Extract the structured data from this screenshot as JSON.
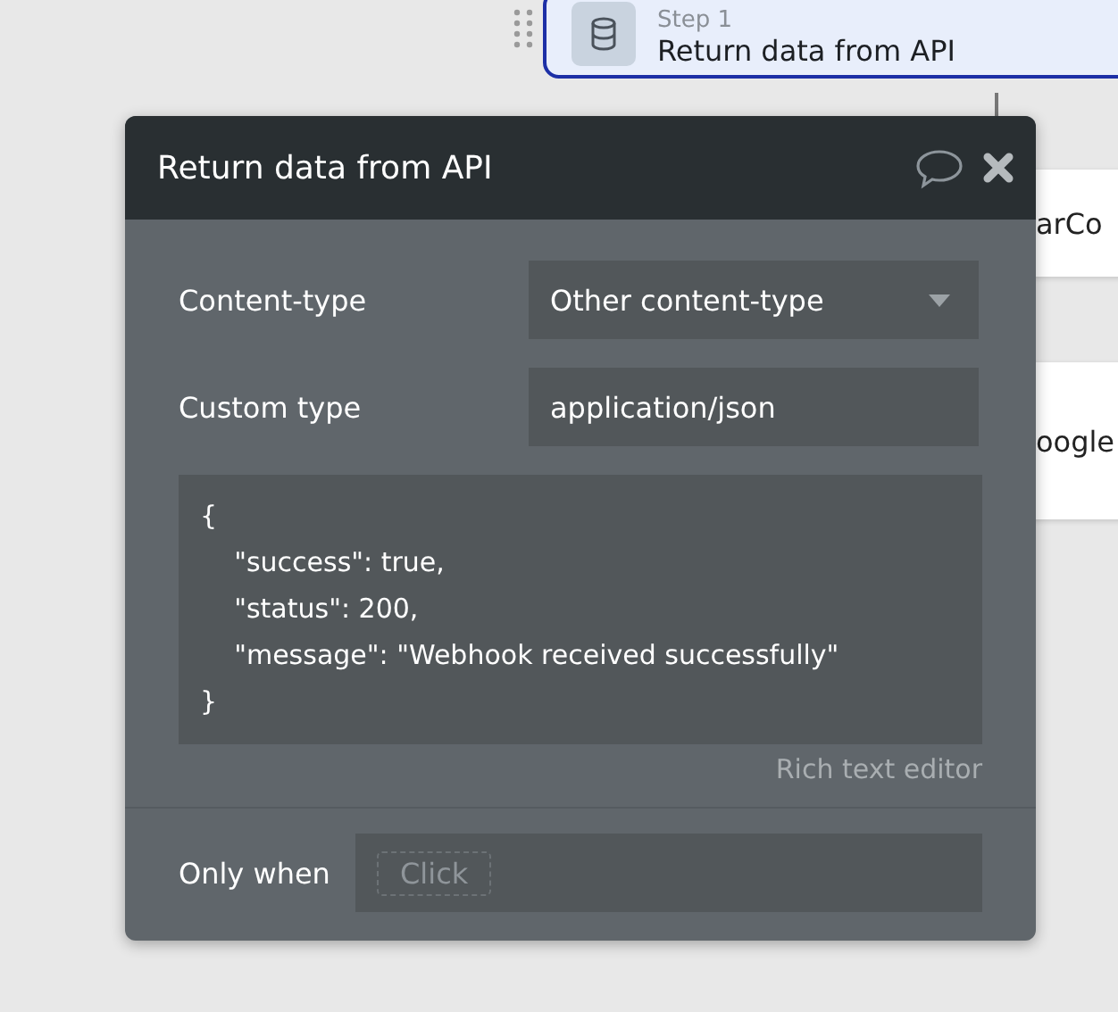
{
  "step_card": {
    "step": "Step 1",
    "title": "Return data from API",
    "selected": true
  },
  "background_cards": [
    {
      "text": "arCo"
    },
    {
      "text": "oogle"
    }
  ],
  "dialog": {
    "title": "Return data from API",
    "fields": [
      {
        "kind": "dropdown",
        "label": "Content-type",
        "value": "Other content-type"
      },
      {
        "kind": "text",
        "label": "Custom type",
        "value": "application/json"
      }
    ],
    "code_lines": [
      "{",
      "    \"success\": true,",
      "    \"status\": 200,",
      "    \"message\": \"Webhook received successfully\"",
      "}"
    ],
    "editor_link": "Rich text editor",
    "condition": {
      "label": "Only when",
      "placeholder": "Click"
    }
  }
}
